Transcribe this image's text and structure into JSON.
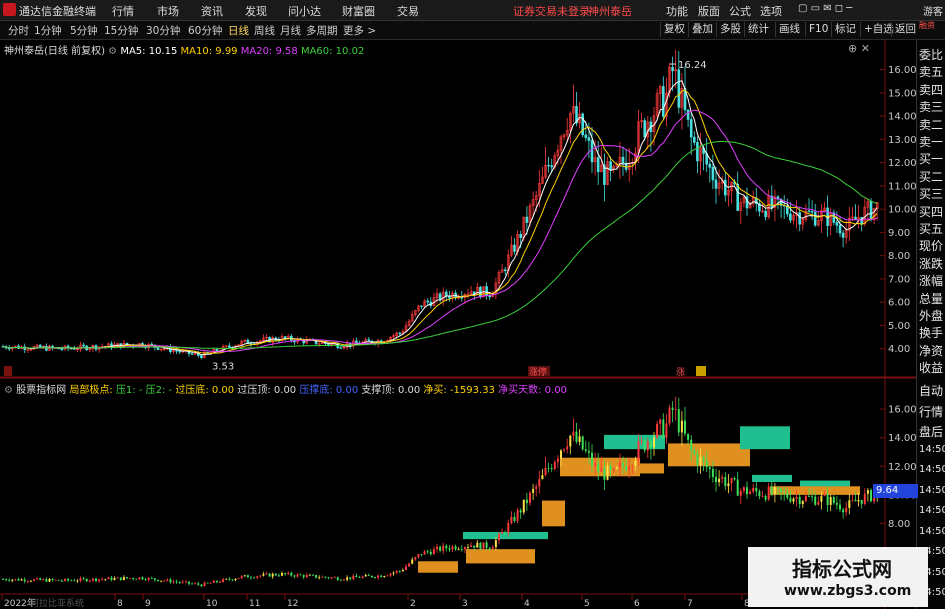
{
  "menubar": {
    "app_title": "通达信金融终端",
    "items": [
      "行情",
      "市场",
      "资讯",
      "发现",
      "问小达",
      "财富圈",
      "交易"
    ],
    "warning": "证券交易未登录",
    "stock_name": "神州泰岳",
    "right_items": [
      "功能",
      "版面",
      "公式",
      "选项"
    ],
    "guest": "游客"
  },
  "toolbar": {
    "periods": [
      "分时",
      "1分钟",
      "5分钟",
      "15分钟",
      "30分钟",
      "60分钟",
      "日线",
      "周线",
      "月线",
      "多周期",
      "更多 >"
    ],
    "selected": "日线",
    "right_buttons": [
      "复权",
      "叠加",
      "多股",
      "统计",
      "画线",
      "F10",
      "标记",
      "+自选",
      "返回"
    ]
  },
  "main_chart": {
    "title": "神州泰岳(日线 前复权)",
    "ma5_label": "MA5: 10.15",
    "ma10_label": "MA10: 9.99",
    "ma20_label": "MA20: 9.58",
    "ma60_label": "MA60: 10.02",
    "high_label": "16.24",
    "low_label": "3.53",
    "event_tags": [
      "涨停",
      "涨"
    ],
    "y_ticks": [
      "16.00",
      "15.00",
      "14.00",
      "13.00",
      "12.00",
      "11.00",
      "10.00",
      "9.00",
      "8.00",
      "7.00",
      "6.00",
      "5.00",
      "4.00"
    ]
  },
  "sub_chart": {
    "title": "股票指标网",
    "indicator": "局部极点:",
    "items": [
      "压1: -",
      "压2: -",
      "过压底: 0.00",
      "过压顶: 0.00",
      "压撑底: 0.00",
      "支撑顶: 0.00",
      "净买: -1593.33",
      "净买天数: 0.00"
    ],
    "y_ticks": [
      "16.00",
      "14.00",
      "12.00",
      "10.00",
      "8.00"
    ],
    "price_badge": "9.64",
    "x_ticks": [
      "2022年",
      "8",
      "9",
      "10",
      "11",
      "12",
      "2",
      "3",
      "4",
      "5",
      "6",
      "7",
      "8"
    ],
    "footer_text": "阿拉比亚系统"
  },
  "right_column": {
    "top_label": "融资",
    "items": [
      "委比",
      "卖五",
      "卖四",
      "卖三",
      "卖二",
      "卖一",
      "买一",
      "买二",
      "买三",
      "买四",
      "买五",
      "现价",
      "涨跌",
      "涨幅",
      "总量",
      "外盘",
      "换手",
      "净资",
      "收益"
    ],
    "items2": [
      "自动",
      "行情",
      "盘后",
      "14:50",
      "14:50",
      "14:50",
      "14:50",
      "14:50",
      "14:50",
      "14:50",
      "14:50"
    ]
  },
  "watermark": {
    "line1": "指标公式网",
    "line2": "www.zbgs3.com"
  },
  "colors": {
    "up": "#ff3b3b",
    "down": "#48e0e0",
    "ma5": "#ffffff",
    "ma10": "#ffd200",
    "ma20": "#e040ff",
    "ma60": "#3cd03c",
    "teal_box": "#1fbf8f",
    "orange_box": "#e0901f"
  }
}
